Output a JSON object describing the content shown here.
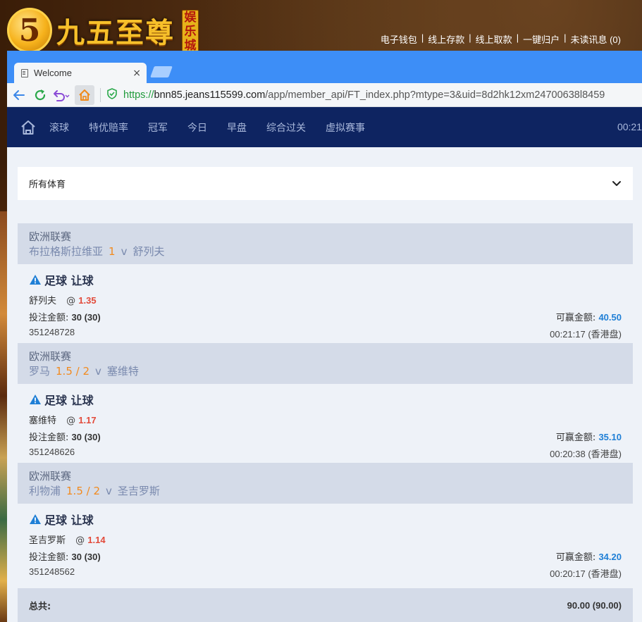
{
  "site": {
    "logo_numeral": "5",
    "logo_text": "九五至尊",
    "logo_badge": "娱乐城",
    "top_links": [
      "电子钱包",
      "线上存款",
      "线上取款",
      "一键归户",
      "未读讯息 (0)"
    ],
    "separator": "|"
  },
  "browser": {
    "tab_title": "Welcome",
    "tab_close": "×",
    "url_scheme": "https://",
    "url_host": "bnn85.jeans115599.com",
    "url_path": "/app/member_api/FT_index.php?mtype=3&uid=8d2hk12xm24700638l8459"
  },
  "nav": {
    "items": [
      "滚球",
      "特优赔率",
      "冠军",
      "今日",
      "早盘",
      "综合过关",
      "虚拟赛事"
    ],
    "clock": "00:21"
  },
  "sport_select": {
    "label": "所有体育"
  },
  "bets": [
    {
      "league": "欧洲联赛",
      "home": "布拉格斯拉维亚",
      "handicap": "1",
      "vs": "v",
      "away": "舒列夫",
      "bet_type": "足球 让球",
      "pick": "舒列夫",
      "at": "@",
      "odds": "1.35",
      "stake_label": "投注金额:",
      "stake_value": "30 (30)",
      "win_label": "可赢金额:",
      "win_value": "40.50",
      "ticket": "351248728",
      "time": "00:21:17 (香港盘)"
    },
    {
      "league": "欧洲联赛",
      "home": "罗马",
      "handicap": "1.5 / 2",
      "vs": "v",
      "away": "塞维特",
      "bet_type": "足球 让球",
      "pick": "塞维特",
      "at": "@",
      "odds": "1.17",
      "stake_label": "投注金额:",
      "stake_value": "30 (30)",
      "win_label": "可赢金额:",
      "win_value": "35.10",
      "ticket": "351248626",
      "time": "00:20:38 (香港盘)"
    },
    {
      "league": "欧洲联赛",
      "home": "利物浦",
      "handicap": "1.5 / 2",
      "vs": "v",
      "away": "圣吉罗斯",
      "bet_type": "足球 让球",
      "pick": "圣吉罗斯",
      "at": "@",
      "odds": "1.14",
      "stake_label": "投注金额:",
      "stake_value": "30 (30)",
      "win_label": "可赢金额:",
      "win_value": "34.20",
      "ticket": "351248562",
      "time": "00:20:17 (香港盘)"
    }
  ],
  "total": {
    "label": "总共:",
    "value": "90.00 (90.00)"
  },
  "colors": {
    "navbar": "#0e2461",
    "tabstrip": "#3d8ef7",
    "handicap": "#f28a1e",
    "odds": "#e24a3a",
    "win": "#1f7fd6",
    "group_header": "#d4dbe8",
    "page_bg": "#eef2f8"
  },
  "icons": [
    "home-icon",
    "back-arrow-icon",
    "reload-icon",
    "undo-icon",
    "shield-check-icon",
    "warning-icon",
    "chevron-down-icon",
    "page-icon",
    "close-icon"
  ]
}
